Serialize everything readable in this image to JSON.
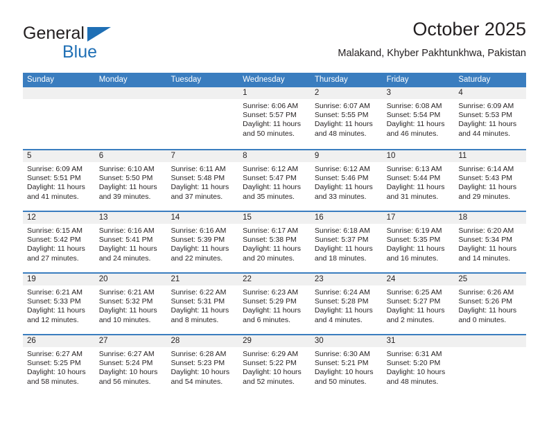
{
  "brand": {
    "name_part1": "General",
    "name_part2": "Blue",
    "accent_color": "#1f6fb5"
  },
  "header": {
    "title": "October 2025",
    "subtitle": "Malakand, Khyber Pakhtunkhwa, Pakistan"
  },
  "calendar": {
    "header_bg": "#3a7dbf",
    "weekdays": [
      "Sunday",
      "Monday",
      "Tuesday",
      "Wednesday",
      "Thursday",
      "Friday",
      "Saturday"
    ],
    "weeks": [
      [
        {
          "day": "",
          "sunrise": "",
          "sunset": "",
          "daylight": ""
        },
        {
          "day": "",
          "sunrise": "",
          "sunset": "",
          "daylight": ""
        },
        {
          "day": "",
          "sunrise": "",
          "sunset": "",
          "daylight": ""
        },
        {
          "day": "1",
          "sunrise": "Sunrise: 6:06 AM",
          "sunset": "Sunset: 5:57 PM",
          "daylight": "Daylight: 11 hours and 50 minutes."
        },
        {
          "day": "2",
          "sunrise": "Sunrise: 6:07 AM",
          "sunset": "Sunset: 5:55 PM",
          "daylight": "Daylight: 11 hours and 48 minutes."
        },
        {
          "day": "3",
          "sunrise": "Sunrise: 6:08 AM",
          "sunset": "Sunset: 5:54 PM",
          "daylight": "Daylight: 11 hours and 46 minutes."
        },
        {
          "day": "4",
          "sunrise": "Sunrise: 6:09 AM",
          "sunset": "Sunset: 5:53 PM",
          "daylight": "Daylight: 11 hours and 44 minutes."
        }
      ],
      [
        {
          "day": "5",
          "sunrise": "Sunrise: 6:09 AM",
          "sunset": "Sunset: 5:51 PM",
          "daylight": "Daylight: 11 hours and 41 minutes."
        },
        {
          "day": "6",
          "sunrise": "Sunrise: 6:10 AM",
          "sunset": "Sunset: 5:50 PM",
          "daylight": "Daylight: 11 hours and 39 minutes."
        },
        {
          "day": "7",
          "sunrise": "Sunrise: 6:11 AM",
          "sunset": "Sunset: 5:48 PM",
          "daylight": "Daylight: 11 hours and 37 minutes."
        },
        {
          "day": "8",
          "sunrise": "Sunrise: 6:12 AM",
          "sunset": "Sunset: 5:47 PM",
          "daylight": "Daylight: 11 hours and 35 minutes."
        },
        {
          "day": "9",
          "sunrise": "Sunrise: 6:12 AM",
          "sunset": "Sunset: 5:46 PM",
          "daylight": "Daylight: 11 hours and 33 minutes."
        },
        {
          "day": "10",
          "sunrise": "Sunrise: 6:13 AM",
          "sunset": "Sunset: 5:44 PM",
          "daylight": "Daylight: 11 hours and 31 minutes."
        },
        {
          "day": "11",
          "sunrise": "Sunrise: 6:14 AM",
          "sunset": "Sunset: 5:43 PM",
          "daylight": "Daylight: 11 hours and 29 minutes."
        }
      ],
      [
        {
          "day": "12",
          "sunrise": "Sunrise: 6:15 AM",
          "sunset": "Sunset: 5:42 PM",
          "daylight": "Daylight: 11 hours and 27 minutes."
        },
        {
          "day": "13",
          "sunrise": "Sunrise: 6:16 AM",
          "sunset": "Sunset: 5:41 PM",
          "daylight": "Daylight: 11 hours and 24 minutes."
        },
        {
          "day": "14",
          "sunrise": "Sunrise: 6:16 AM",
          "sunset": "Sunset: 5:39 PM",
          "daylight": "Daylight: 11 hours and 22 minutes."
        },
        {
          "day": "15",
          "sunrise": "Sunrise: 6:17 AM",
          "sunset": "Sunset: 5:38 PM",
          "daylight": "Daylight: 11 hours and 20 minutes."
        },
        {
          "day": "16",
          "sunrise": "Sunrise: 6:18 AM",
          "sunset": "Sunset: 5:37 PM",
          "daylight": "Daylight: 11 hours and 18 minutes."
        },
        {
          "day": "17",
          "sunrise": "Sunrise: 6:19 AM",
          "sunset": "Sunset: 5:35 PM",
          "daylight": "Daylight: 11 hours and 16 minutes."
        },
        {
          "day": "18",
          "sunrise": "Sunrise: 6:20 AM",
          "sunset": "Sunset: 5:34 PM",
          "daylight": "Daylight: 11 hours and 14 minutes."
        }
      ],
      [
        {
          "day": "19",
          "sunrise": "Sunrise: 6:21 AM",
          "sunset": "Sunset: 5:33 PM",
          "daylight": "Daylight: 11 hours and 12 minutes."
        },
        {
          "day": "20",
          "sunrise": "Sunrise: 6:21 AM",
          "sunset": "Sunset: 5:32 PM",
          "daylight": "Daylight: 11 hours and 10 minutes."
        },
        {
          "day": "21",
          "sunrise": "Sunrise: 6:22 AM",
          "sunset": "Sunset: 5:31 PM",
          "daylight": "Daylight: 11 hours and 8 minutes."
        },
        {
          "day": "22",
          "sunrise": "Sunrise: 6:23 AM",
          "sunset": "Sunset: 5:29 PM",
          "daylight": "Daylight: 11 hours and 6 minutes."
        },
        {
          "day": "23",
          "sunrise": "Sunrise: 6:24 AM",
          "sunset": "Sunset: 5:28 PM",
          "daylight": "Daylight: 11 hours and 4 minutes."
        },
        {
          "day": "24",
          "sunrise": "Sunrise: 6:25 AM",
          "sunset": "Sunset: 5:27 PM",
          "daylight": "Daylight: 11 hours and 2 minutes."
        },
        {
          "day": "25",
          "sunrise": "Sunrise: 6:26 AM",
          "sunset": "Sunset: 5:26 PM",
          "daylight": "Daylight: 11 hours and 0 minutes."
        }
      ],
      [
        {
          "day": "26",
          "sunrise": "Sunrise: 6:27 AM",
          "sunset": "Sunset: 5:25 PM",
          "daylight": "Daylight: 10 hours and 58 minutes."
        },
        {
          "day": "27",
          "sunrise": "Sunrise: 6:27 AM",
          "sunset": "Sunset: 5:24 PM",
          "daylight": "Daylight: 10 hours and 56 minutes."
        },
        {
          "day": "28",
          "sunrise": "Sunrise: 6:28 AM",
          "sunset": "Sunset: 5:23 PM",
          "daylight": "Daylight: 10 hours and 54 minutes."
        },
        {
          "day": "29",
          "sunrise": "Sunrise: 6:29 AM",
          "sunset": "Sunset: 5:22 PM",
          "daylight": "Daylight: 10 hours and 52 minutes."
        },
        {
          "day": "30",
          "sunrise": "Sunrise: 6:30 AM",
          "sunset": "Sunset: 5:21 PM",
          "daylight": "Daylight: 10 hours and 50 minutes."
        },
        {
          "day": "31",
          "sunrise": "Sunrise: 6:31 AM",
          "sunset": "Sunset: 5:20 PM",
          "daylight": "Daylight: 10 hours and 48 minutes."
        },
        {
          "day": "",
          "sunrise": "",
          "sunset": "",
          "daylight": ""
        }
      ]
    ]
  }
}
